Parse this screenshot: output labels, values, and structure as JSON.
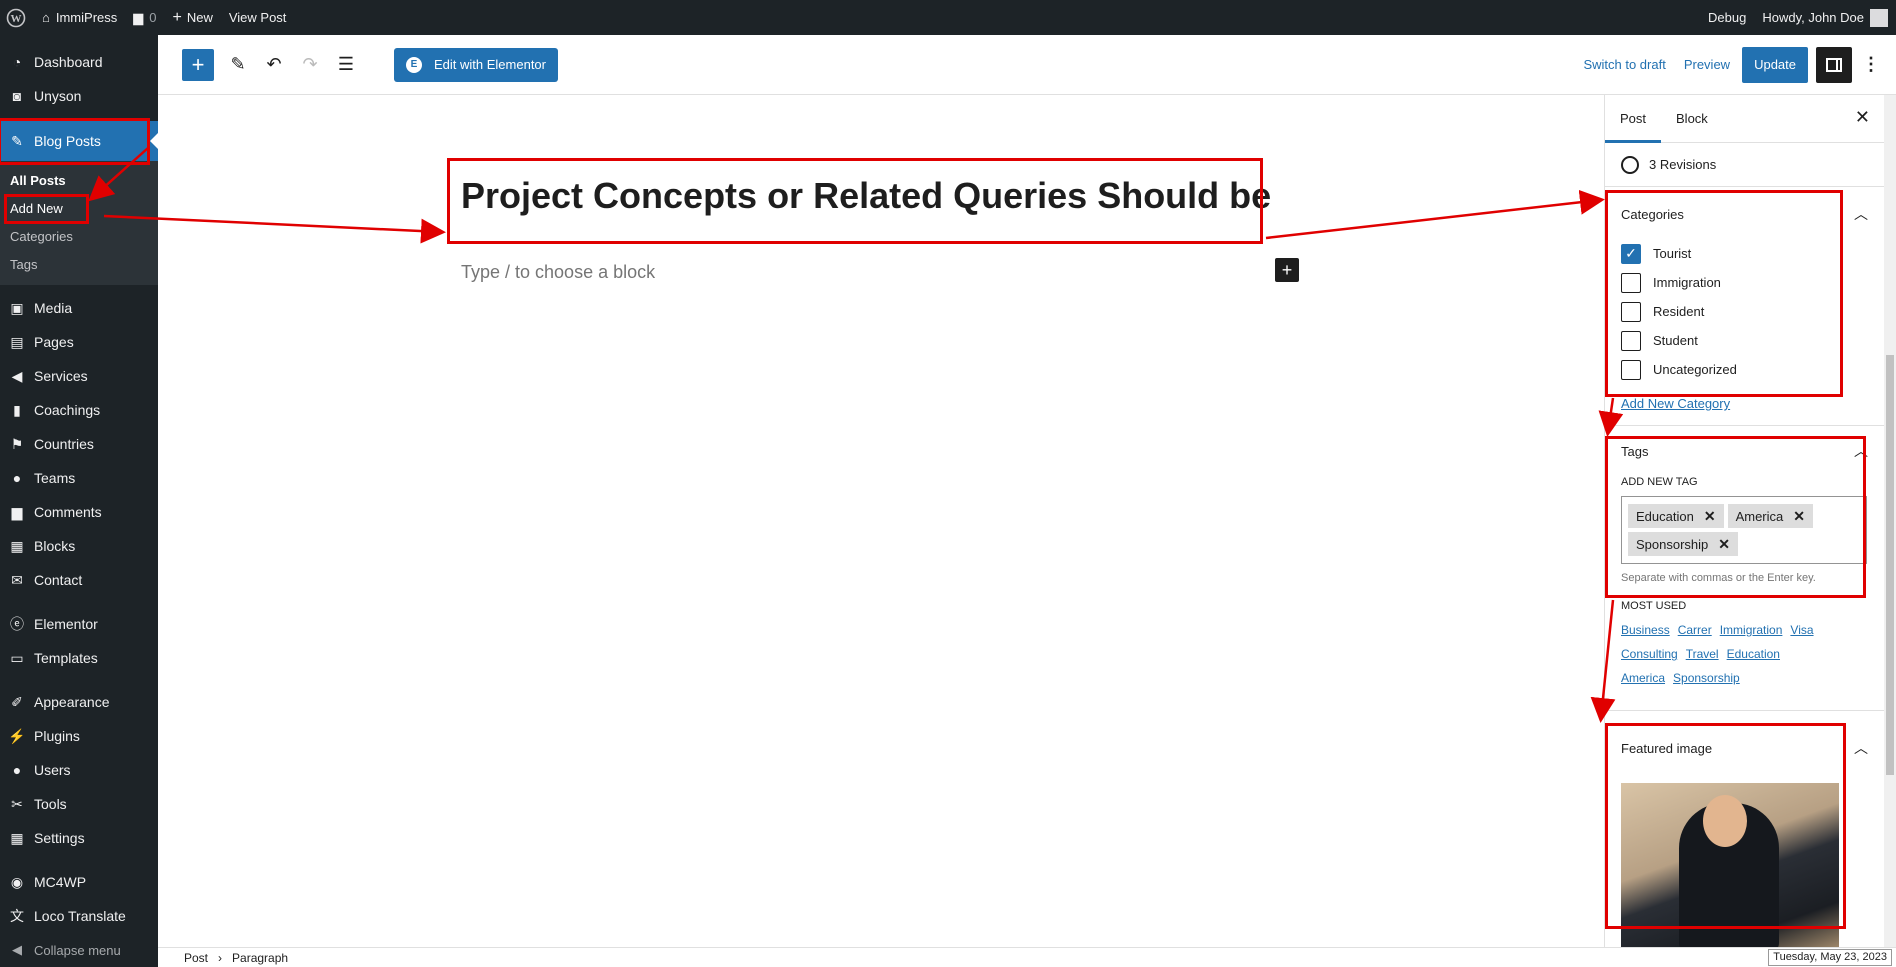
{
  "admin_bar": {
    "site_name": "ImmiPress",
    "comments_count": "0",
    "new_label": "New",
    "view_post_label": "View Post",
    "debug_label": "Debug",
    "greeting": "Howdy, John Doe"
  },
  "sidebar": {
    "items_top": [
      {
        "label": "Dashboard",
        "icon": "dashboard-icon"
      },
      {
        "label": "Unyson",
        "icon": "unyson-icon"
      }
    ],
    "current": {
      "label": "Blog Posts",
      "icon": "pin-icon"
    },
    "submenu": [
      "All Posts",
      "Add New",
      "Categories",
      "Tags"
    ],
    "items_mid": [
      {
        "label": "Media",
        "icon": "media-icon"
      },
      {
        "label": "Pages",
        "icon": "pages-icon"
      },
      {
        "label": "Services",
        "icon": "megaphone-icon"
      },
      {
        "label": "Coachings",
        "icon": "book-icon"
      },
      {
        "label": "Countries",
        "icon": "flag-icon"
      },
      {
        "label": "Teams",
        "icon": "user-icon"
      },
      {
        "label": "Comments",
        "icon": "comment-icon"
      },
      {
        "label": "Blocks",
        "icon": "blocks-icon"
      },
      {
        "label": "Contact",
        "icon": "mail-icon"
      }
    ],
    "items_elementor": [
      {
        "label": "Elementor",
        "icon": "elementor-icon"
      },
      {
        "label": "Templates",
        "icon": "folder-icon"
      }
    ],
    "items_bottom": [
      {
        "label": "Appearance",
        "icon": "brush-icon"
      },
      {
        "label": "Plugins",
        "icon": "plugin-icon"
      },
      {
        "label": "Users",
        "icon": "user-icon"
      },
      {
        "label": "Tools",
        "icon": "wrench-icon"
      },
      {
        "label": "Settings",
        "icon": "settings-icon"
      }
    ],
    "items_extra": [
      {
        "label": "MC4WP",
        "icon": "mc4wp-icon"
      },
      {
        "label": "Loco Translate",
        "icon": "translate-icon"
      }
    ],
    "collapse_label": "Collapse menu"
  },
  "toolbar": {
    "elementor_label": "Edit with Elementor",
    "switch_to_draft": "Switch to draft",
    "preview": "Preview",
    "update": "Update"
  },
  "editor": {
    "title": "Project Concepts or Related Queries Should be",
    "placeholder": "Type / to choose a block"
  },
  "panel": {
    "tabs": [
      "Post",
      "Block"
    ],
    "revisions": "3 Revisions",
    "categories": {
      "heading": "Categories",
      "items": [
        {
          "label": "Tourist",
          "checked": true
        },
        {
          "label": "Immigration",
          "checked": false
        },
        {
          "label": "Resident",
          "checked": false
        },
        {
          "label": "Student",
          "checked": false
        },
        {
          "label": "Uncategorized",
          "checked": false
        }
      ],
      "add_new": "Add New Category"
    },
    "tags": {
      "heading": "Tags",
      "add_new_label": "ADD NEW TAG",
      "chips": [
        "Education",
        "America",
        "Sponsorship"
      ],
      "help": "Separate with commas or the Enter key.",
      "most_used_label": "MOST USED",
      "most_used": [
        "Business",
        "Carrer",
        "Immigration",
        "Visa",
        "Consulting",
        "Travel",
        "Education",
        "America",
        "Sponsorship"
      ]
    },
    "featured_image": {
      "heading": "Featured image"
    }
  },
  "status_bar": {
    "crumbs": [
      "Post",
      "Paragraph"
    ],
    "date": "Tuesday, May 23, 2023"
  },
  "colors": {
    "accent": "#2271b1",
    "admin_dark": "#1d2327",
    "annotation_red": "#e00000"
  }
}
